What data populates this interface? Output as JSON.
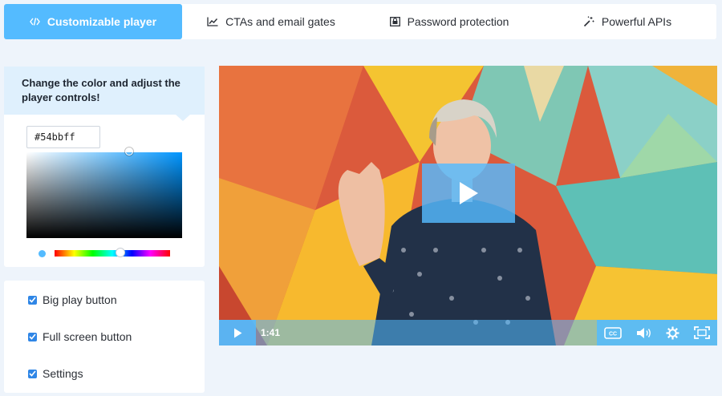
{
  "tabs": [
    {
      "label": "Customizable player",
      "icon": "code-icon",
      "active": true
    },
    {
      "label": "CTAs and email gates",
      "icon": "chart-line-icon",
      "active": false
    },
    {
      "label": "Password protection",
      "icon": "lock-screen-icon",
      "active": false
    },
    {
      "label": "Powerful APIs",
      "icon": "magic-wand-icon",
      "active": false
    }
  ],
  "color_panel": {
    "heading": "Change the color and adjust the player controls!",
    "hex_value": "#54bbff",
    "accent_color": "#54bbff"
  },
  "options": [
    {
      "label": "Big play button",
      "checked": true
    },
    {
      "label": "Full screen button",
      "checked": true
    },
    {
      "label": "Settings",
      "checked": true
    }
  ],
  "player": {
    "time": "1:41",
    "controls": [
      "play-icon",
      "closed-captions-icon",
      "volume-icon",
      "settings-gear-icon",
      "fullscreen-icon"
    ]
  }
}
